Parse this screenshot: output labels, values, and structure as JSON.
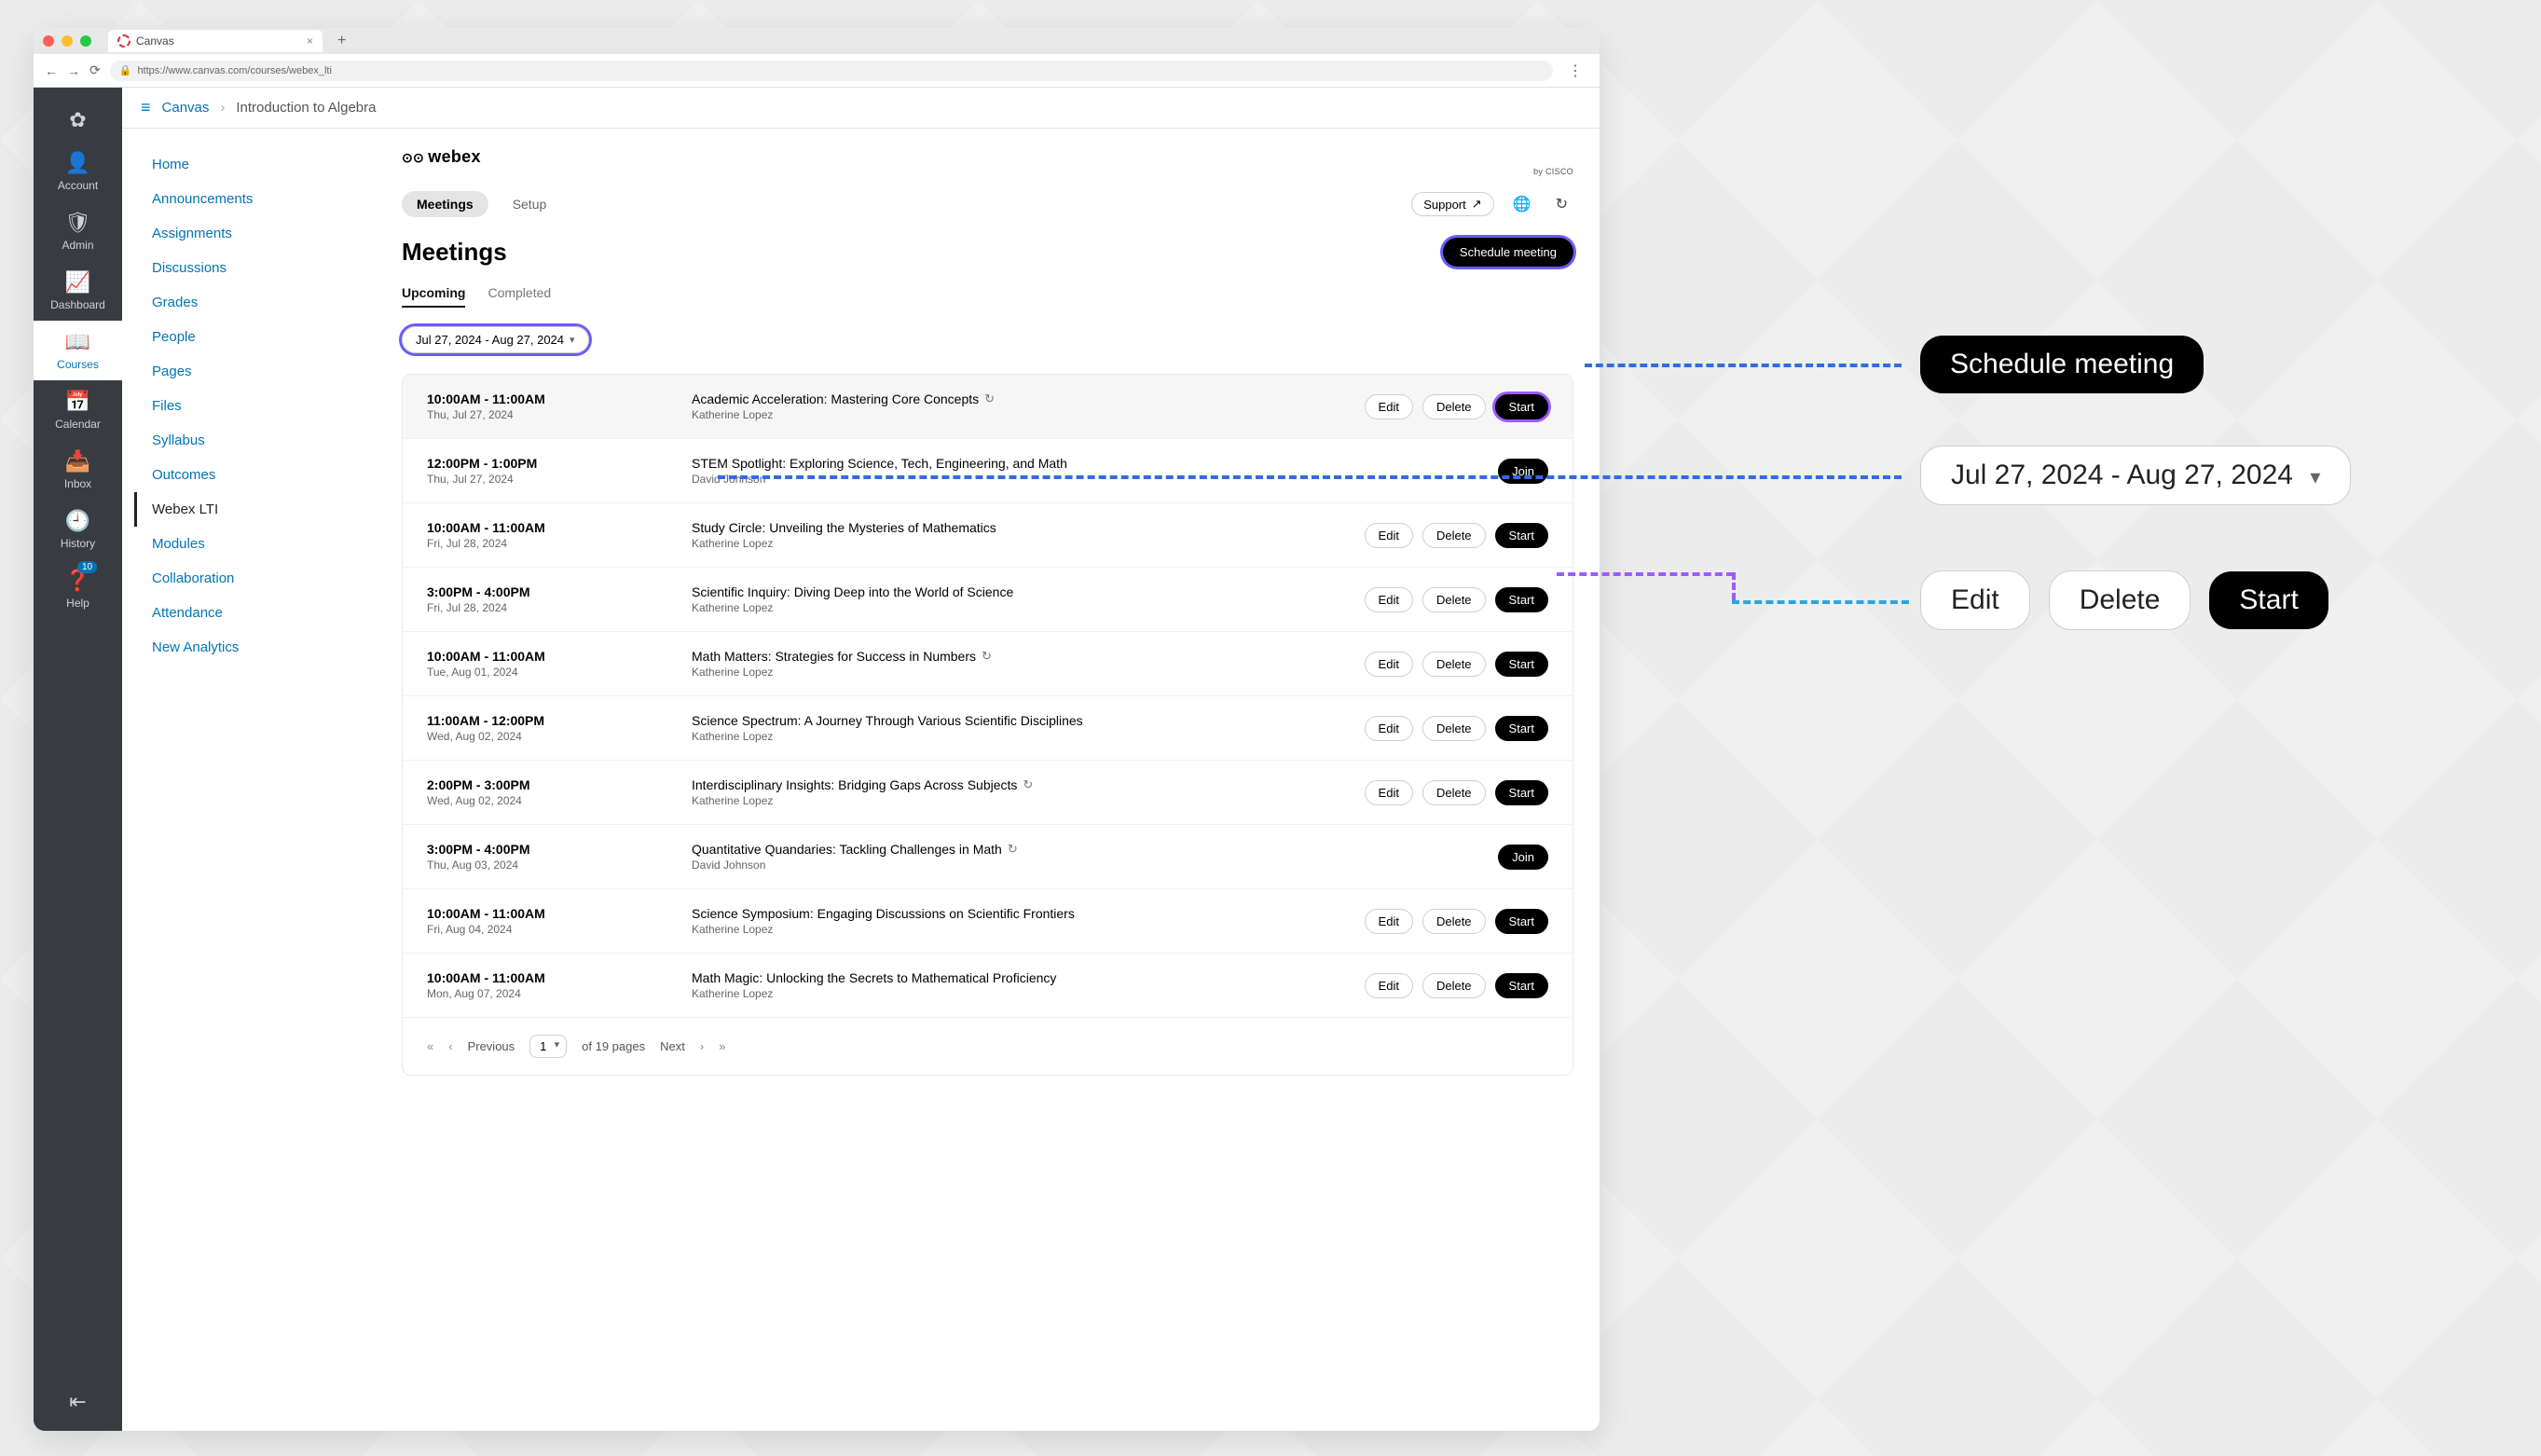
{
  "browser": {
    "tab_title": "Canvas",
    "url": "https://www.canvas.com/courses/webex_lti"
  },
  "rail": {
    "items": [
      {
        "icon": "✿",
        "label": ""
      },
      {
        "icon": "👤",
        "label": "Account"
      },
      {
        "icon": "⚙",
        "label": "Admin"
      },
      {
        "icon": "📈",
        "label": "Dashboard"
      },
      {
        "icon": "📖",
        "label": "Courses"
      },
      {
        "icon": "📅",
        "label": "Calendar"
      },
      {
        "icon": "📥",
        "label": "Inbox"
      },
      {
        "icon": "🕘",
        "label": "History"
      },
      {
        "icon": "❓",
        "label": "Help"
      }
    ],
    "help_badge": "10"
  },
  "breadcrumb": {
    "root": "Canvas",
    "leaf": "Introduction to Algebra"
  },
  "course_nav": [
    "Home",
    "Announcements",
    "Assignments",
    "Discussions",
    "Grades",
    "People",
    "Pages",
    "Files",
    "Syllabus",
    "Outcomes",
    "Webex LTI",
    "Modules",
    "Collaboration",
    "Attendance",
    "New Analytics"
  ],
  "course_nav_active": "Webex LTI",
  "webex": {
    "logo_primary": "webex",
    "logo_sub": "by CISCO",
    "nav": {
      "meetings": "Meetings",
      "setup": "Setup"
    },
    "support_label": "Support",
    "title": "Meetings",
    "schedule_label": "Schedule meeting",
    "tabs": {
      "upcoming": "Upcoming",
      "completed": "Completed"
    },
    "date_range": "Jul 27, 2024 - Aug 27, 2024",
    "action_labels": {
      "edit": "Edit",
      "delete": "Delete",
      "start": "Start",
      "join": "Join"
    },
    "pagination": {
      "previous": "Previous",
      "next": "Next",
      "current_page": "1",
      "total_text": "of 19 pages"
    }
  },
  "meetings": [
    {
      "time": "10:00AM - 11:00AM",
      "date": "Thu, Jul 27, 2024",
      "title": "Academic Acceleration: Mastering Core Concepts",
      "host": "Katherine Lopez",
      "recurring": true,
      "actions": [
        "edit",
        "delete",
        "start"
      ],
      "highlight": true,
      "ringed_start": true
    },
    {
      "time": "12:00PM - 1:00PM",
      "date": "Thu, Jul 27, 2024",
      "title": "STEM Spotlight: Exploring Science, Tech, Engineering, and Math",
      "host": "David Johnson",
      "recurring": false,
      "actions": [
        "join"
      ]
    },
    {
      "time": "10:00AM - 11:00AM",
      "date": "Fri, Jul 28, 2024",
      "title": "Study Circle: Unveiling the Mysteries of Mathematics",
      "host": "Katherine Lopez",
      "recurring": false,
      "actions": [
        "edit",
        "delete",
        "start"
      ]
    },
    {
      "time": "3:00PM - 4:00PM",
      "date": "Fri, Jul 28, 2024",
      "title": "Scientific Inquiry: Diving Deep into the World of Science",
      "host": "Katherine Lopez",
      "recurring": false,
      "actions": [
        "edit",
        "delete",
        "start"
      ]
    },
    {
      "time": "10:00AM - 11:00AM",
      "date": "Tue, Aug 01, 2024",
      "title": "Math Matters: Strategies for Success in Numbers",
      "host": "Katherine Lopez",
      "recurring": true,
      "actions": [
        "edit",
        "delete",
        "start"
      ]
    },
    {
      "time": "11:00AM - 12:00PM",
      "date": "Wed, Aug 02, 2024",
      "title": "Science Spectrum: A Journey Through Various Scientific Disciplines",
      "host": "Katherine Lopez",
      "recurring": false,
      "actions": [
        "edit",
        "delete",
        "start"
      ]
    },
    {
      "time": "2:00PM - 3:00PM",
      "date": "Wed, Aug 02, 2024",
      "title": "Interdisciplinary Insights: Bridging Gaps Across Subjects",
      "host": "Katherine Lopez",
      "recurring": true,
      "actions": [
        "edit",
        "delete",
        "start"
      ]
    },
    {
      "time": "3:00PM - 4:00PM",
      "date": "Thu, Aug 03, 2024",
      "title": "Quantitative Quandaries: Tackling Challenges in Math",
      "host": "David Johnson",
      "recurring": true,
      "actions": [
        "join"
      ]
    },
    {
      "time": "10:00AM - 11:00AM",
      "date": "Fri, Aug 04, 2024",
      "title": "Science Symposium: Engaging Discussions on Scientific Frontiers",
      "host": "Katherine Lopez",
      "recurring": false,
      "actions": [
        "edit",
        "delete",
        "start"
      ]
    },
    {
      "time": "10:00AM - 11:00AM",
      "date": "Mon, Aug 07, 2024",
      "title": "Math Magic: Unlocking the Secrets to Mathematical Proficiency",
      "host": "Katherine Lopez",
      "recurring": false,
      "actions": [
        "edit",
        "delete",
        "start"
      ]
    }
  ],
  "callouts": {
    "schedule": "Schedule meeting",
    "date_range": "Jul 27, 2024 - Aug 27, 2024",
    "edit": "Edit",
    "delete": "Delete",
    "start": "Start"
  },
  "colors": {
    "dash_blue": "#2f6de0",
    "dash_purple": "#9a5cff",
    "dash_cyan": "#2aa7e0"
  }
}
